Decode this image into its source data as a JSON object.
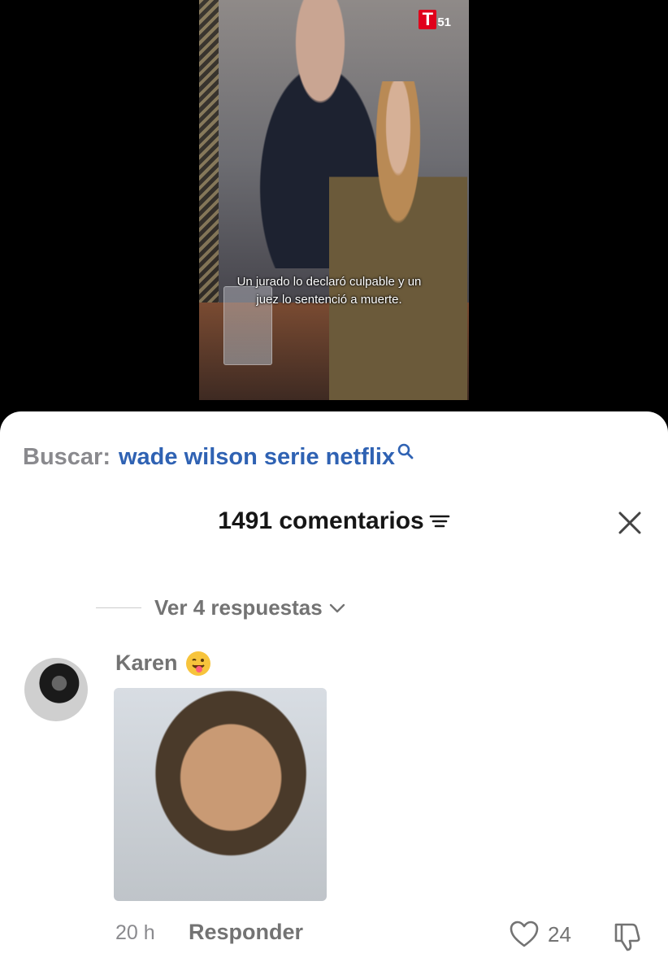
{
  "video": {
    "logo_number": "51",
    "logo_letter": "T",
    "caption": "Un jurado lo declaró culpable y un juez lo sentenció a muerte."
  },
  "search": {
    "label": "Buscar:",
    "query": "wade wilson serie netflix"
  },
  "comments_header": {
    "count_label": "1491 comentarios"
  },
  "replies": {
    "label": "Ver 4 respuestas"
  },
  "comment": {
    "username": "Karen",
    "emoji": "😜",
    "timestamp": "20 h",
    "reply_label": "Responder",
    "like_count": "24"
  },
  "colors": {
    "search_query": "#2f62b3",
    "muted_text": "#737373",
    "logo_red": "#e0001b"
  }
}
